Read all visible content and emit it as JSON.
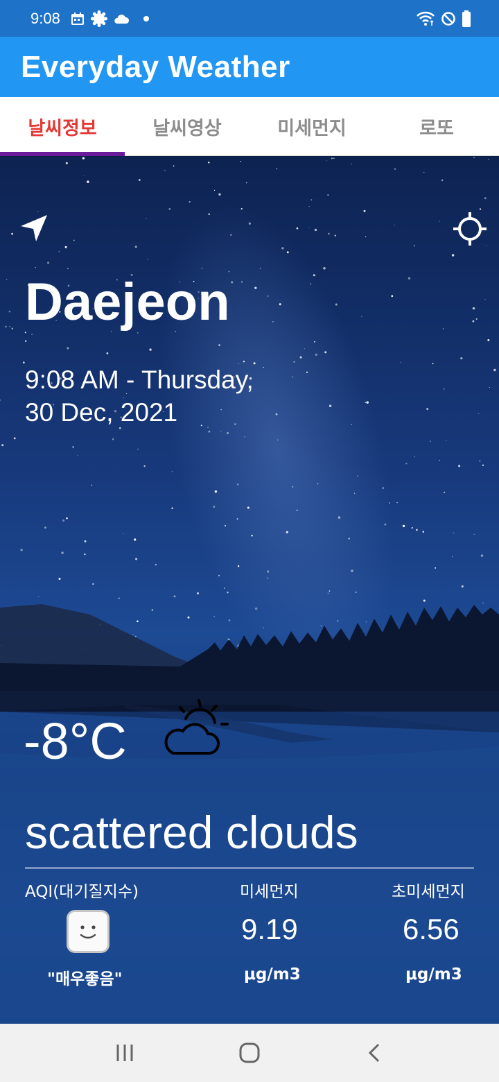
{
  "status_bar": {
    "time": "9:08",
    "left_icons": [
      "calendar-icon",
      "settings-badge-icon",
      "cloud-icon",
      "notification-dot-icon"
    ],
    "right_icons": [
      "wifi-icon",
      "do-not-disturb-icon",
      "battery-icon"
    ]
  },
  "app": {
    "title": "Everyday Weather"
  },
  "tabs": [
    {
      "label": "날씨정보",
      "active": true
    },
    {
      "label": "날씨영상",
      "active": false
    },
    {
      "label": "미세먼지",
      "active": false
    },
    {
      "label": "로또",
      "active": false
    }
  ],
  "weather": {
    "city": "Daejeon",
    "datetime_line1": "9:08 AM - Thursday,",
    "datetime_line2": "30 Dec, 2021",
    "temperature": "-8°C",
    "description": "scattered clouds",
    "icon": "partly-cloudy-icon"
  },
  "air": {
    "aqi_label": "AQI(대기질지수)",
    "aqi_status": "\"매우좋음\"",
    "aqi_icon": "smiley-face-icon",
    "pm10_label": "미세먼지",
    "pm10_value": "9.19",
    "pm10_unit": "μg/m3",
    "pm25_label": "초미세먼지",
    "pm25_value": "6.56",
    "pm25_unit": "μg/m3"
  },
  "nav": [
    "recent-apps-icon",
    "home-icon",
    "back-icon"
  ],
  "colors": {
    "status_bar": "#1e73c8",
    "app_bar": "#2196f3",
    "active_tab_text": "#e53935",
    "active_tab_indicator": "#6a1b9a",
    "inactive_tab_text": "#8c8c8c"
  }
}
